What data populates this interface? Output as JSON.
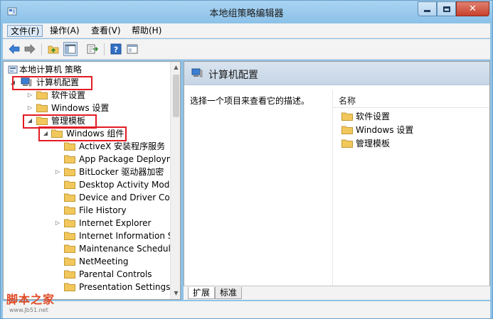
{
  "window": {
    "title": "本地组策略编辑器",
    "close_glyph": "✕"
  },
  "menu": {
    "items": [
      "文件(F)",
      "操作(A)",
      "查看(V)",
      "帮助(H)"
    ]
  },
  "toolbar": {
    "icons": [
      "back-arrow-icon",
      "forward-arrow-icon",
      "up-folder-icon",
      "show-hide-tree-icon",
      "export-list-icon",
      "help-icon",
      "properties-icon"
    ]
  },
  "tree": {
    "root": "本地计算机 策略",
    "computer_config": "计算机配置",
    "software_settings": "软件设置",
    "windows_settings": "Windows 设置",
    "admin_templates": "管理模板",
    "windows_components": "Windows 组件",
    "components": [
      "ActiveX 安装程序服务",
      "App Package Deployment",
      "BitLocker 驱动器加密",
      "Desktop Activity Moderator",
      "Device and Driver Compatibility",
      "File History",
      "Internet Explorer",
      "Internet Information Services",
      "Maintenance Scheduler",
      "NetMeeting",
      "Parental Controls",
      "Presentation Settings"
    ],
    "expand_arrow": "▷",
    "collapse_arrow": "◢"
  },
  "scrollbar": {
    "up": "▲",
    "down": "▼"
  },
  "right_pane": {
    "title": "计算机配置",
    "description": "选择一个项目来查看它的描述。",
    "column_header": "名称",
    "items": [
      "软件设置",
      "Windows 设置",
      "管理模板"
    ]
  },
  "tabs": {
    "extended": "扩展",
    "standard": "标准"
  },
  "watermark": {
    "main": "脚本之家",
    "sub": "www.Jb51.net"
  },
  "colors": {
    "highlight_box": "#e31b23",
    "folder_yellow": "#f2c75c",
    "title_bar": "#8ec2e8"
  }
}
